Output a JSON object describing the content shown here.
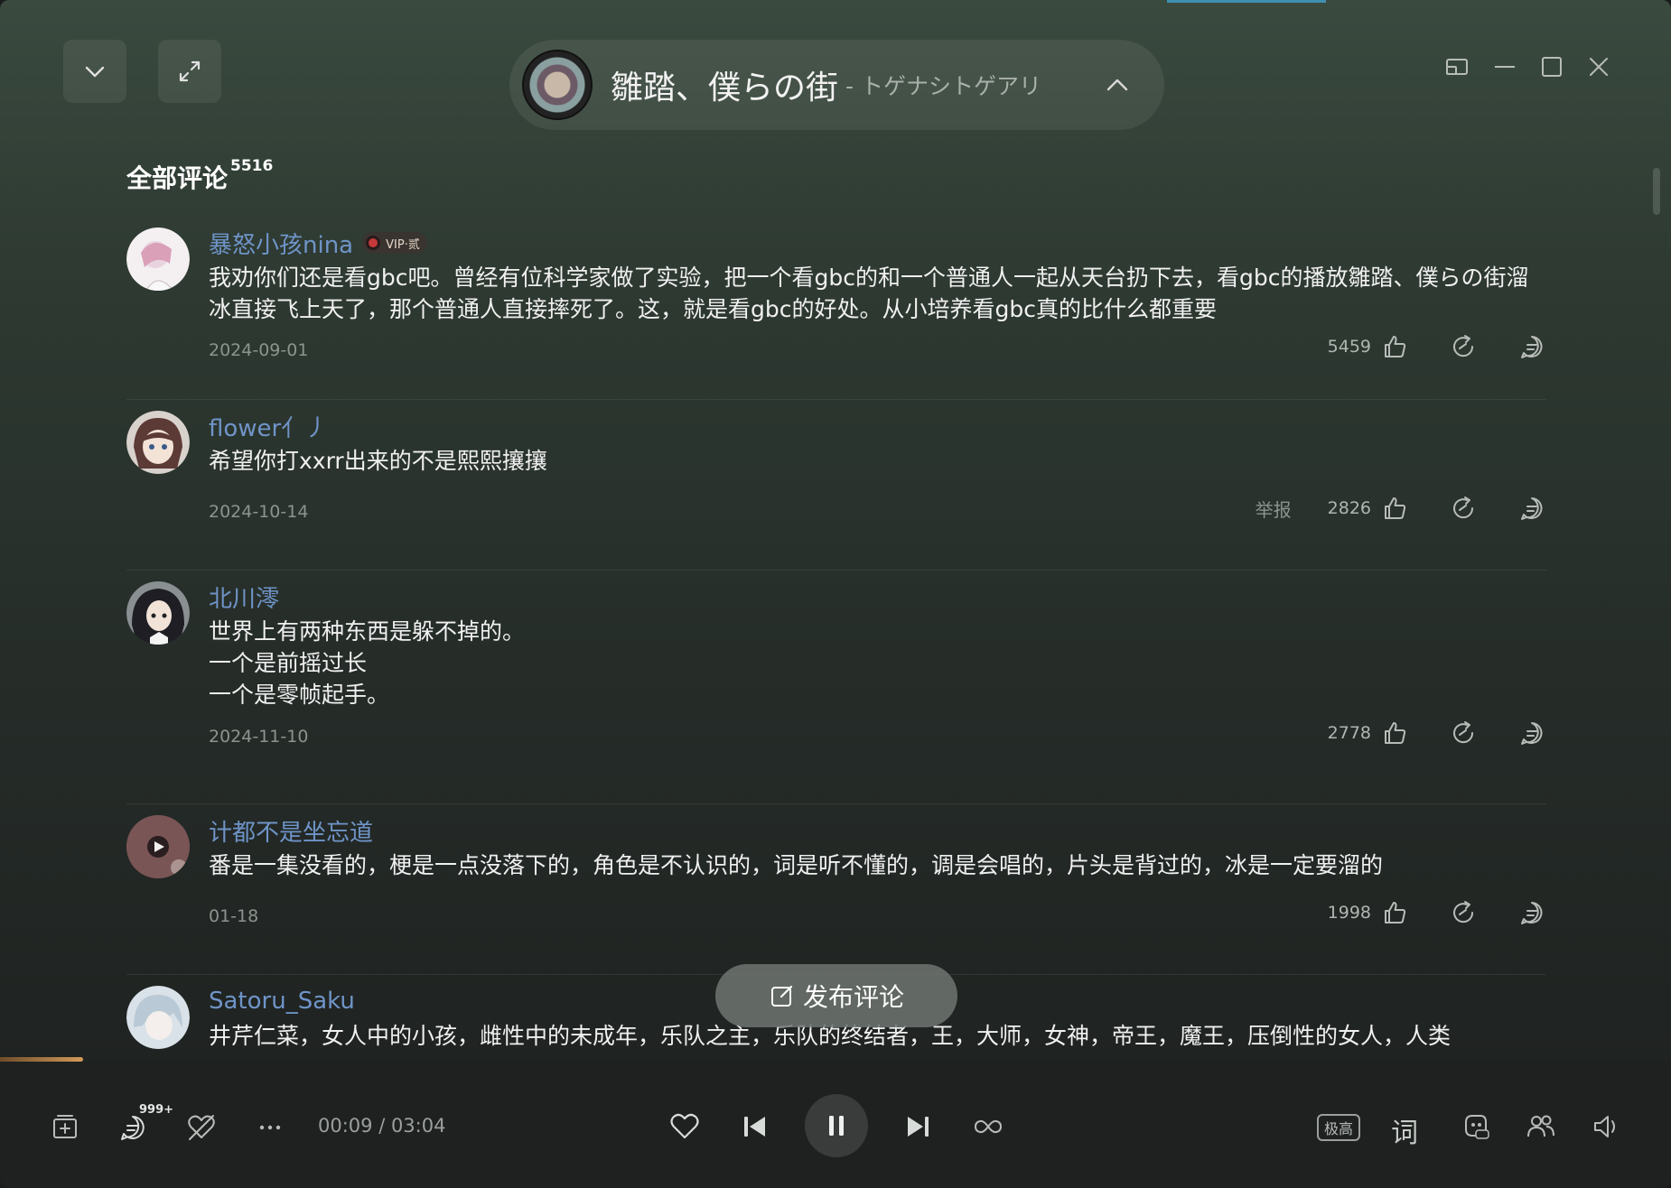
{
  "now_playing": {
    "title": "雛踏、僕らの街",
    "artist": "- トゲナシトゲアリ"
  },
  "comments_section": {
    "title": "全部评论",
    "count": "5516"
  },
  "comments": [
    {
      "user": "暴怒小孩nina",
      "vip": "VIP·贰",
      "text": "我劝你们还是看gbc吧。曾经有位科学家做了实验，把一个看gbc的和一个普通人一起从天台扔下去，看gbc的播放雛踏、僕らの街溜冰直接飞上天了，那个普通人直接摔死了。这，就是看gbc的好处。从小培养看gbc真的比什么都重要",
      "date": "2024-09-01",
      "likes": "5459",
      "report": ""
    },
    {
      "user": "flower亻丿",
      "vip": "",
      "text": "希望你打xxrr出来的不是熙熙攘攘",
      "date": "2024-10-14",
      "likes": "2826",
      "report": "举报"
    },
    {
      "user": "北川澪",
      "vip": "",
      "text": "世界上有两种东西是躲不掉的。\n一个是前摇过长\n一个是零帧起手。",
      "date": "2024-11-10",
      "likes": "2778",
      "report": ""
    },
    {
      "user": "计都不是坐忘道",
      "vip": "",
      "text": "番是一集没看的，梗是一点没落下的，角色是不认识的，词是听不懂的，调是会唱的，片头是背过的，冰是一定要溜的",
      "date": "01-18",
      "likes": "1998",
      "report": ""
    },
    {
      "user": "Satoru_Saku",
      "vip": "",
      "text": "井芹仁菜，女人中的小孩，雌性中的未成年，乐队之主，乐队的终结者，王，大师，女神，帝王，魔王，压倒性的女人，人类",
      "date": "",
      "likes": "",
      "report": ""
    }
  ],
  "publish_button": "发布评论",
  "player": {
    "comment_badge": "999+",
    "time": "00:09 / 03:04",
    "quality": "极高",
    "lyric": "词"
  },
  "colors": {
    "username": "#6f94c8",
    "accent_progress": "#d39a5a"
  }
}
